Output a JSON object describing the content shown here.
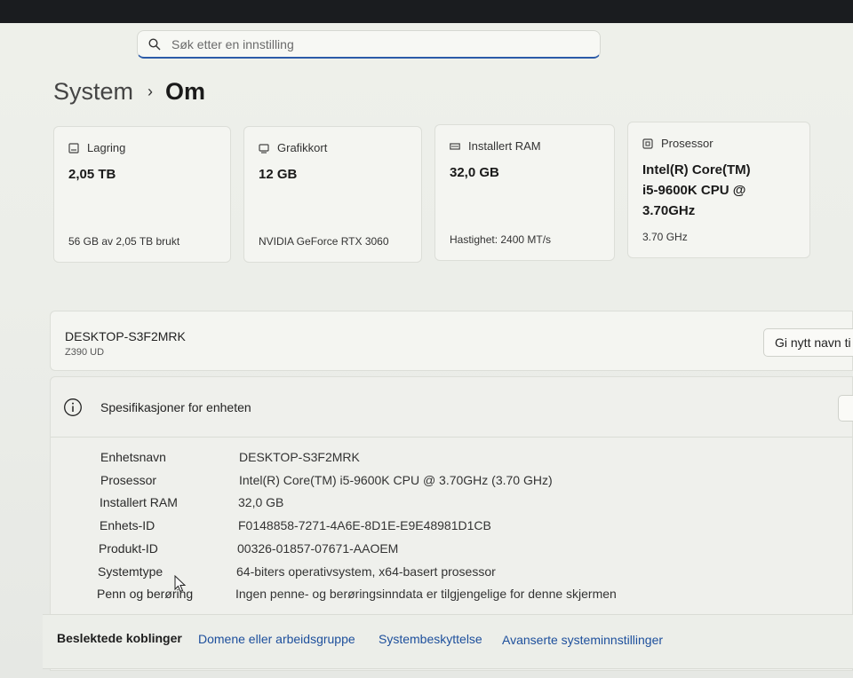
{
  "search": {
    "placeholder": "Søk etter en innstilling"
  },
  "breadcrumb": {
    "parent": "System",
    "separator": "›",
    "current": "Om"
  },
  "cards": [
    {
      "icon": "storage-icon",
      "title": "Lagring",
      "value": "2,05 TB",
      "sub": "56 GB av 2,05 TB brukt"
    },
    {
      "icon": "graphics-card-icon",
      "title": "Grafikkort",
      "value": "12 GB",
      "sub": "NVIDIA GeForce RTX 3060"
    },
    {
      "icon": "ram-icon",
      "title": "Installert RAM",
      "value": "32,0 GB",
      "sub": "Hastighet: 2400 MT/s"
    },
    {
      "icon": "processor-icon",
      "title": "Prosessor",
      "value_lines": [
        "Intel(R) Core(TM)",
        "i5-9600K CPU @",
        "3.70GHz"
      ],
      "sub": "3.70 GHz"
    }
  ],
  "device": {
    "name": "DESKTOP-S3F2MRK",
    "model": "Z390 UD",
    "rename_button": "Gi nytt navn ti"
  },
  "specs": {
    "title": "Spesifikasjoner for enheten",
    "rows": [
      {
        "label": "Enhetsnavn",
        "value": "DESKTOP-S3F2MRK"
      },
      {
        "label": "Prosessor",
        "value": "Intel(R) Core(TM) i5-9600K CPU @ 3.70GHz (3.70 GHz)"
      },
      {
        "label": "Installert RAM",
        "value": "32,0 GB"
      },
      {
        "label": "Enhets-ID",
        "value": "F0148858-7271-4A6E-8D1E-E9E48981D1CB"
      },
      {
        "label": "Produkt-ID",
        "value": "00326-01857-07671-AAOEM"
      },
      {
        "label": "Systemtype",
        "value": "64-biters operativsystem, x64-basert prosessor"
      },
      {
        "label": "Penn og berøring",
        "value": "Ingen penne- og berøringsinndata er tilgjengelige for denne skjermen"
      }
    ]
  },
  "related_links": {
    "heading": "Beslektede koblinger",
    "items": [
      "Domene eller arbeidsgruppe",
      "Systembeskyttelse",
      "Avanserte systeminnstillinger"
    ]
  },
  "colors": {
    "accent": "#2c5ba8",
    "link": "#1d4f9c"
  }
}
